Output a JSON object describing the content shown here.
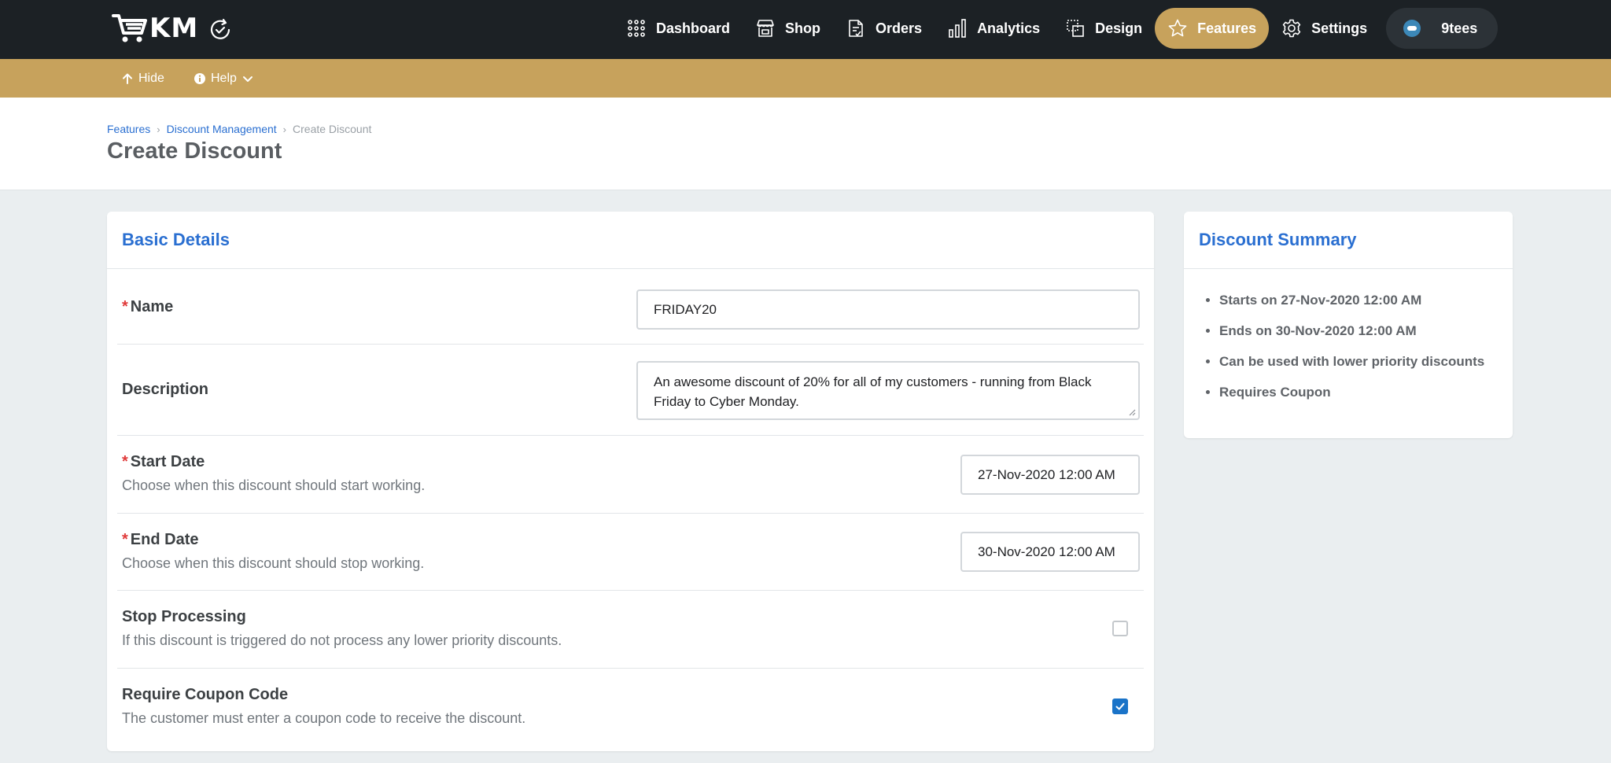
{
  "app": {
    "logo_text": "KM"
  },
  "nav": {
    "items": [
      {
        "label": "Dashboard",
        "icon": "grid-dots-icon"
      },
      {
        "label": "Shop",
        "icon": "storefront-icon"
      },
      {
        "label": "Orders",
        "icon": "document-icon"
      },
      {
        "label": "Analytics",
        "icon": "bar-chart-icon"
      },
      {
        "label": "Design",
        "icon": "design-frame-icon"
      },
      {
        "label": "Features",
        "icon": "star-icon",
        "active": true
      },
      {
        "label": "Settings",
        "icon": "gear-icon"
      }
    ],
    "user_label": "9tees"
  },
  "subbar": {
    "hide_label": "Hide",
    "help_label": "Help"
  },
  "breadcrumb": {
    "items": [
      "Features",
      "Discount Management"
    ],
    "current": "Create Discount"
  },
  "page_title": "Create Discount",
  "basic_details": {
    "title": "Basic Details",
    "name": {
      "label": "Name",
      "value": "FRIDAY20"
    },
    "description": {
      "label": "Description",
      "value": "An awesome discount of 20% for all of my customers - running from Black Friday to Cyber Monday."
    },
    "start_date": {
      "label": "Start Date",
      "help": "Choose when this discount should start working.",
      "value": "27-Nov-2020 12:00 AM"
    },
    "end_date": {
      "label": "End Date",
      "help": "Choose when this discount should stop working.",
      "value": "30-Nov-2020 12:00 AM"
    },
    "stop_processing": {
      "label": "Stop Processing",
      "help": "If this discount is triggered do not process any lower priority discounts.",
      "checked": false
    },
    "require_coupon": {
      "label": "Require Coupon Code",
      "help": "The customer must enter a coupon code to receive the discount.",
      "checked": true
    }
  },
  "summary": {
    "title": "Discount Summary",
    "items": [
      "Starts on 27-Nov-2020 12:00 AM",
      "Ends on 30-Nov-2020 12:00 AM",
      "Can be used with lower priority discounts",
      "Requires Coupon"
    ]
  },
  "colors": {
    "nav_bg": "#1c2125",
    "accent_gold": "#c7a25c",
    "link_blue": "#2a6fd1",
    "checkbox_blue": "#1a73c8",
    "required_red": "#e03a3a"
  }
}
